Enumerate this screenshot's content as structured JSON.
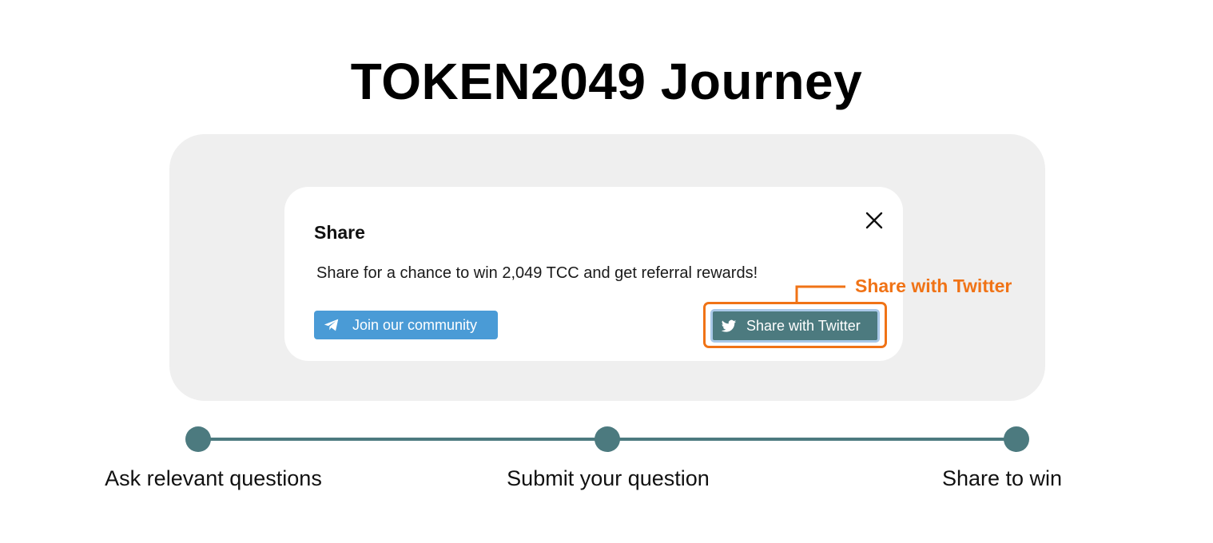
{
  "page": {
    "title": "TOKEN2049 Journey"
  },
  "modal": {
    "title": "Share",
    "message": "Share for a chance to win 2,049 TCC and get referral rewards!",
    "close_icon": "close-icon",
    "join_button": {
      "label": "Join our community",
      "icon": "telegram-icon",
      "color": "#4a9bd6"
    },
    "twitter_button": {
      "label": "Share with Twitter",
      "icon": "twitter-bird-icon",
      "color": "#4c7a7f"
    }
  },
  "callout": {
    "label": "Share with Twitter",
    "color": "#f07316"
  },
  "timeline": {
    "color": "#4c7a7f",
    "steps": [
      {
        "label": "Ask relevant questions"
      },
      {
        "label": "Submit your question"
      },
      {
        "label": "Share to win"
      }
    ]
  }
}
